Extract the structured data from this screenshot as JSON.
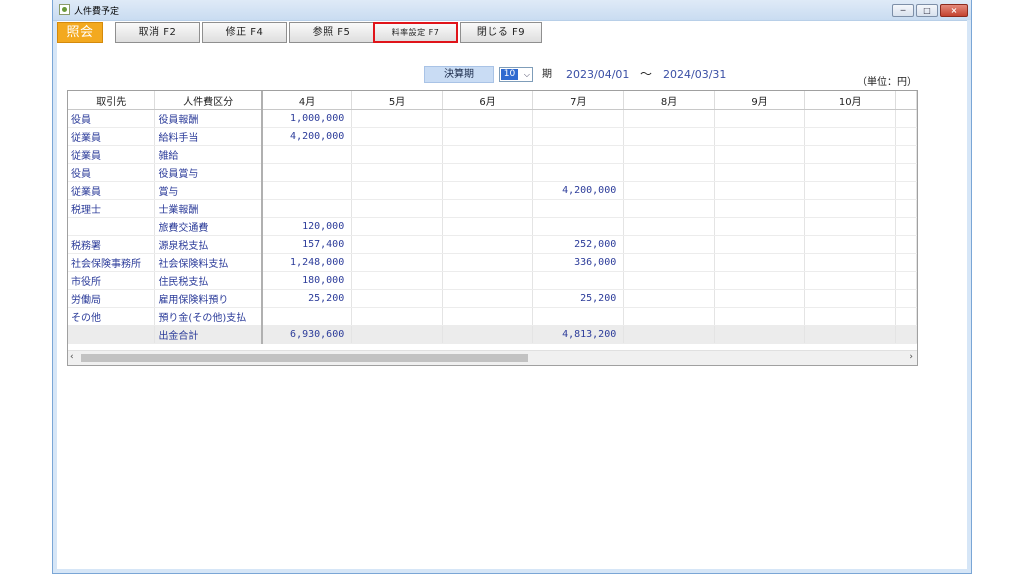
{
  "window": {
    "title": "人件費予定",
    "min_label": "─",
    "max_label": "□",
    "close_label": "×"
  },
  "toolbar": {
    "shokai": "照会",
    "torikeshi": "取消 F2",
    "shusei": "修正 F4",
    "sansho": "参照 F5",
    "ryoritsu": "料率設定 F7",
    "tojiru": "閉じる F9"
  },
  "period": {
    "label": "決算期",
    "value": "10",
    "ki": "期",
    "start": "2023/04/01",
    "tilde": "〜",
    "end": "2024/03/31"
  },
  "unit": "（単位：円）",
  "table": {
    "headers": [
      "取引先",
      "人件費区分",
      "4月",
      "5月",
      "6月",
      "7月",
      "8月",
      "9月",
      "10月"
    ],
    "rows": [
      {
        "partner": "役員",
        "category": "役員報酬",
        "apr": "1,000,000",
        "jul": ""
      },
      {
        "partner": "従業員",
        "category": "給料手当",
        "apr": "4,200,000",
        "jul": ""
      },
      {
        "partner": "従業員",
        "category": "雑給",
        "apr": "",
        "jul": ""
      },
      {
        "partner": "役員",
        "category": "役員賞与",
        "apr": "",
        "jul": ""
      },
      {
        "partner": "従業員",
        "category": "賞与",
        "apr": "",
        "jul": "4,200,000"
      },
      {
        "partner": "税理士",
        "category": "士業報酬",
        "apr": "",
        "jul": ""
      },
      {
        "partner": "",
        "category": "旅費交通費",
        "apr": "120,000",
        "jul": ""
      },
      {
        "partner": "税務署",
        "category": "源泉税支払",
        "apr": "157,400",
        "jul": "252,000"
      },
      {
        "partner": "社会保険事務所",
        "category": "社会保険料支払",
        "apr": "1,248,000",
        "jul": "336,000"
      },
      {
        "partner": "市役所",
        "category": "住民税支払",
        "apr": "180,000",
        "jul": ""
      },
      {
        "partner": "労働局",
        "category": "雇用保険料預り",
        "apr": "25,200",
        "jul": "25,200"
      },
      {
        "partner": "その他",
        "category": "預り金(その他)支払",
        "apr": "",
        "jul": ""
      }
    ],
    "total": {
      "category": "出金合計",
      "apr": "6,930,600",
      "jul": "4,813,200"
    }
  },
  "scroll": {
    "left": "‹",
    "right": "›"
  }
}
